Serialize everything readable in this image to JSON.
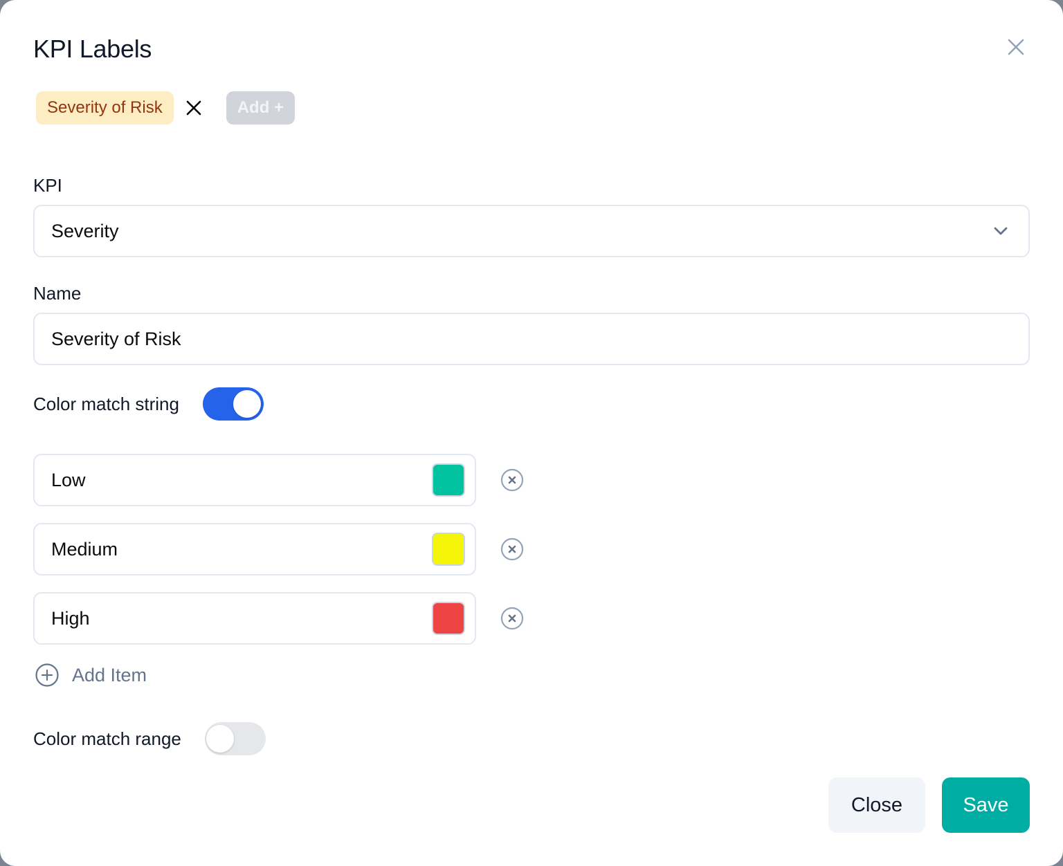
{
  "dialog": {
    "title": "KPI Labels",
    "close_icon": "close-icon"
  },
  "tags": {
    "items": [
      {
        "label": "Severity of Risk",
        "remove_icon": "x-icon"
      }
    ],
    "add_label": "Add +"
  },
  "kpi": {
    "label": "KPI",
    "selected": "Severity",
    "icon": "chevron-down-icon"
  },
  "name": {
    "label": "Name",
    "value": "Severity of Risk"
  },
  "color_match_string": {
    "label": "Color match string",
    "enabled": true,
    "items": [
      {
        "value": "Low",
        "color": "#00c29e"
      },
      {
        "value": "Medium",
        "color": "#f5f50a"
      },
      {
        "value": "High",
        "color": "#ef4444"
      }
    ],
    "add_item_label": "Add Item"
  },
  "color_match_range": {
    "label": "Color match range",
    "enabled": false
  },
  "footer": {
    "close_label": "Close",
    "save_label": "Save"
  },
  "colors": {
    "primary": "#2563eb",
    "save": "#00ada3",
    "tag_bg": "#fdedc4",
    "tag_text": "#93360f"
  }
}
